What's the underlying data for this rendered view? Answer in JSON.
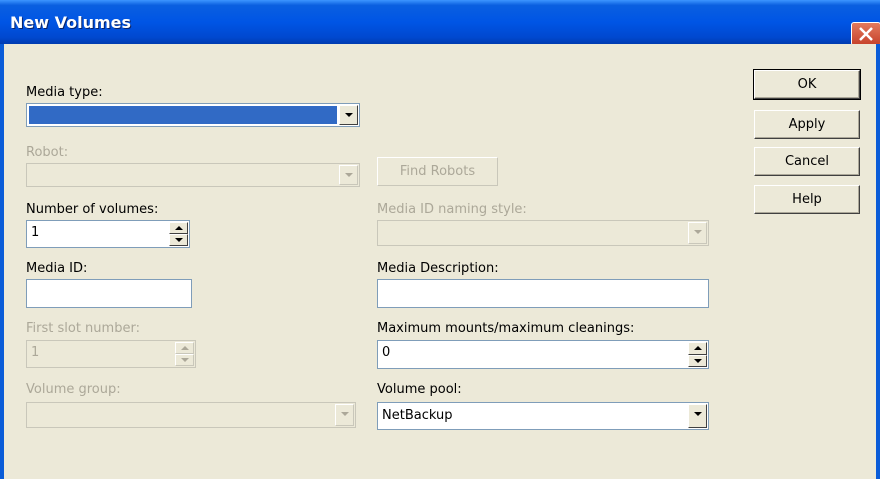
{
  "window": {
    "title": "New Volumes"
  },
  "buttons": {
    "ok": "OK",
    "apply": "Apply",
    "cancel": "Cancel",
    "help": "Help",
    "find_robots": "Find Robots"
  },
  "fields": {
    "media_type": {
      "label": "Media type:",
      "value": ""
    },
    "robot": {
      "label": "Robot:",
      "value": ""
    },
    "number_of_volumes": {
      "label": "Number of volumes:",
      "value": "1"
    },
    "media_id_naming_style": {
      "label": "Media ID naming style:",
      "value": ""
    },
    "media_id": {
      "label": "Media ID:",
      "value": ""
    },
    "media_description": {
      "label": "Media Description:",
      "value": ""
    },
    "first_slot_number": {
      "label": "First slot number:",
      "value": "1"
    },
    "max_mounts": {
      "label": "Maximum mounts/maximum cleanings:",
      "value": "0"
    },
    "volume_group": {
      "label": "Volume group:",
      "value": ""
    },
    "volume_pool": {
      "label": "Volume pool:",
      "value": "NetBackup"
    }
  },
  "colors": {
    "titlebar": "#0055E5",
    "face": "#ECE9D8",
    "selection": "#316AC5",
    "disabled_text": "#ACA899"
  }
}
